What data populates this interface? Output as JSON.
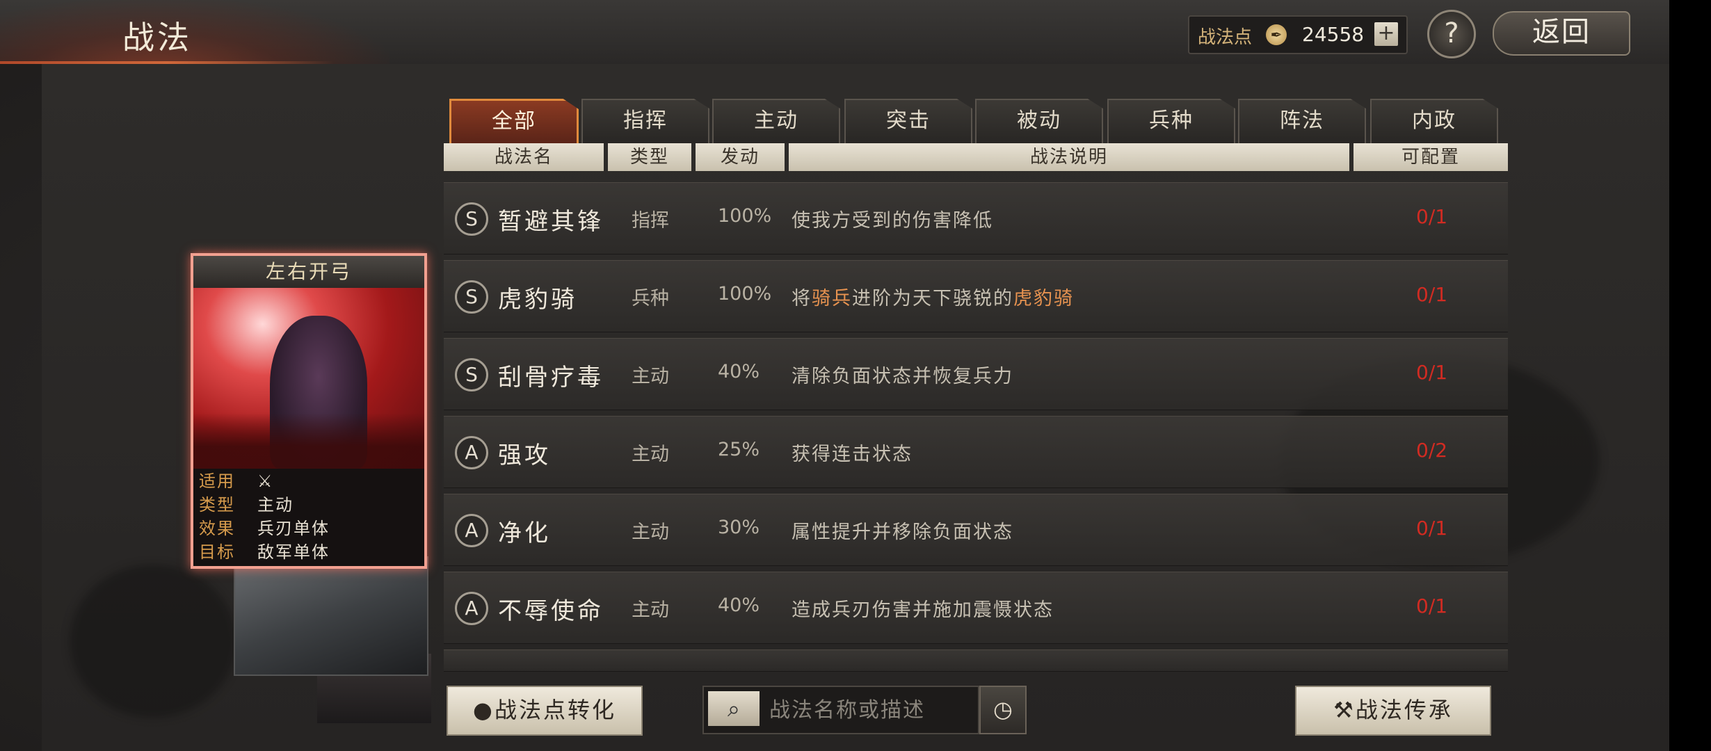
{
  "header": {
    "title": "战法",
    "points_label": "战法点",
    "points_value": "24558",
    "plus_label": "+",
    "help_label": "?",
    "back_label": "返回"
  },
  "tabs": [
    {
      "label": "全部",
      "active": true
    },
    {
      "label": "指挥"
    },
    {
      "label": "主动"
    },
    {
      "label": "突击"
    },
    {
      "label": "被动"
    },
    {
      "label": "兵种"
    },
    {
      "label": "阵法"
    },
    {
      "label": "内政"
    }
  ],
  "columns": {
    "name": "战法名",
    "type": "类型",
    "rate": "发动",
    "desc": "战法说明",
    "cfg": "可配置"
  },
  "skills": [
    {
      "grade": "S",
      "name": "暂避其锋",
      "type": "指挥",
      "rate": "100%",
      "desc": "使我方受到的伤害降低",
      "cfg": "0/1"
    },
    {
      "grade": "S",
      "name": "虎豹骑",
      "type": "兵种",
      "rate": "100%",
      "desc_pre": "将",
      "desc_hl1": "骑兵",
      "desc_mid": "进阶为天下骁锐的",
      "desc_hl2": "虎豹骑",
      "cfg": "0/1"
    },
    {
      "grade": "S",
      "name": "刮骨疗毒",
      "type": "主动",
      "rate": "40%",
      "desc": "清除负面状态并恢复兵力",
      "cfg": "0/1"
    },
    {
      "grade": "A",
      "name": "强攻",
      "type": "主动",
      "rate": "25%",
      "desc": "获得连击状态",
      "cfg": "0/2"
    },
    {
      "grade": "A",
      "name": "净化",
      "type": "主动",
      "rate": "30%",
      "desc": "属性提升并移除负面状态",
      "cfg": "0/1"
    },
    {
      "grade": "A",
      "name": "不辱使命",
      "type": "主动",
      "rate": "40%",
      "desc": "造成兵刃伤害并施加震慑状态",
      "cfg": "0/1"
    }
  ],
  "card": {
    "title": "左右开弓",
    "rows": [
      {
        "key": "适用",
        "val": "⚔"
      },
      {
        "key": "类型",
        "val": "主动"
      },
      {
        "key": "效果",
        "val": "兵刃单体"
      },
      {
        "key": "目标",
        "val": "敌军单体"
      }
    ]
  },
  "bottom": {
    "convert_label": "战法点转化",
    "search_placeholder": "战法名称或描述",
    "inherit_label": "战法传承"
  },
  "colors": {
    "accent_orange": "#e08a3c",
    "config_red": "#d12b22",
    "highlight_orange": "#e89350"
  }
}
